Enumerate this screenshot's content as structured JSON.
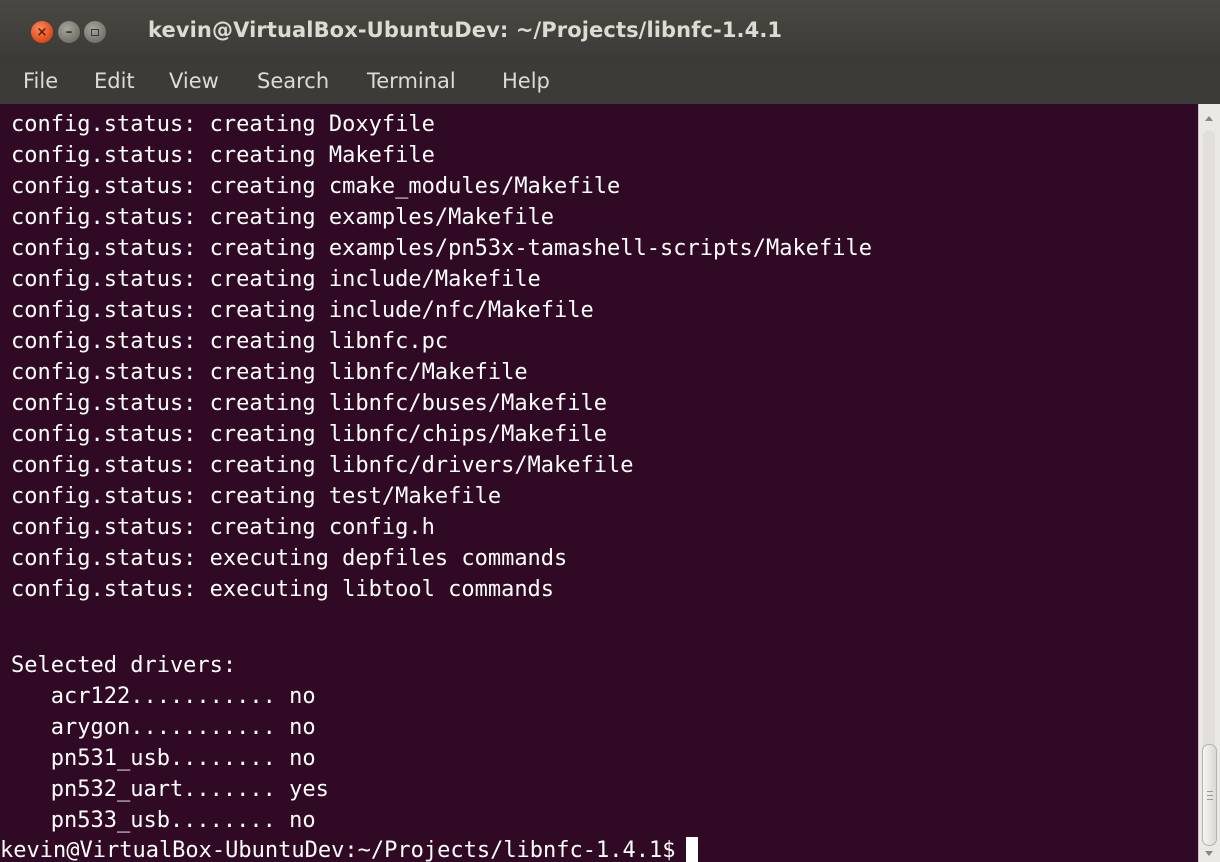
{
  "window": {
    "title": "kevin@VirtualBox-UbuntuDev: ~/Projects/libnfc-1.4.1",
    "close_glyph": "×",
    "minimize_glyph": "–"
  },
  "menu": {
    "items": [
      "File",
      "Edit",
      "View",
      "Search",
      "Terminal",
      "Help"
    ]
  },
  "terminal": {
    "lines": [
      "config.status: creating Doxyfile",
      "config.status: creating Makefile",
      "config.status: creating cmake_modules/Makefile",
      "config.status: creating examples/Makefile",
      "config.status: creating examples/pn53x-tamashell-scripts/Makefile",
      "config.status: creating include/Makefile",
      "config.status: creating include/nfc/Makefile",
      "config.status: creating libnfc.pc",
      "config.status: creating libnfc/Makefile",
      "config.status: creating libnfc/buses/Makefile",
      "config.status: creating libnfc/chips/Makefile",
      "config.status: creating libnfc/drivers/Makefile",
      "config.status: creating test/Makefile",
      "config.status: creating config.h",
      "config.status: executing depfiles commands",
      "config.status: executing libtool commands",
      "",
      "Selected drivers:",
      "   acr122........... no",
      "   arygon........... no",
      "   pn531_usb........ no",
      "   pn532_uart....... yes",
      "   pn533_usb........ no"
    ],
    "prompt": "kevin@VirtualBox-UbuntuDev:~/Projects/libnfc-1.4.1$"
  },
  "colors": {
    "terminal_bg": "#300a24",
    "terminal_fg": "#ffffff",
    "titlebar_bg": "#3c3b37",
    "close_button": "#e4521f"
  }
}
